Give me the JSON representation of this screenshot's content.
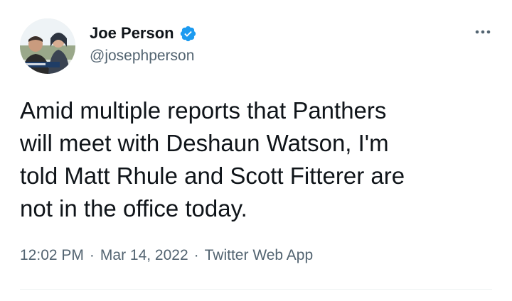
{
  "author": {
    "display_name": "Joe Person",
    "handle": "@josephperson",
    "verified": true,
    "verified_color": "#1d9bf0"
  },
  "tweet": {
    "text": "Amid multiple reports that Panthers\nwill meet with Deshaun Watson, I'm\ntold Matt Rhule and Scott Fitterer are\nnot in the office today."
  },
  "meta": {
    "time": "12:02 PM",
    "separator": "·",
    "date": "Mar 14, 2022",
    "source": "Twitter Web App"
  },
  "icons": {
    "more": "more-horizontal-icon",
    "verified": "verified-badge-icon"
  },
  "colors": {
    "text_primary": "#0f1419",
    "text_secondary": "#536471",
    "divider": "#eff3f4"
  }
}
